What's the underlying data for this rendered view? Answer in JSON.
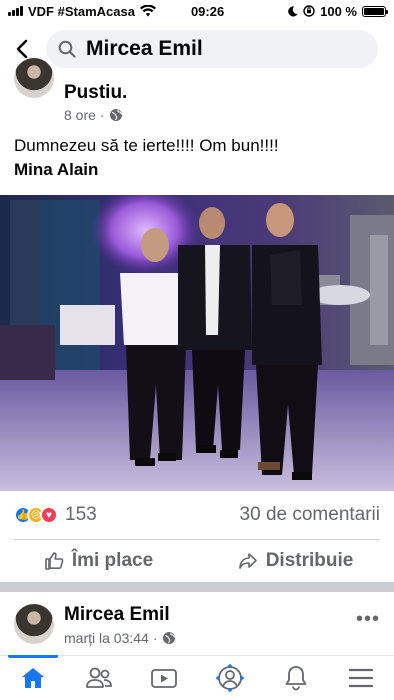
{
  "status_bar": {
    "carrier": "VDF #StamAcasa",
    "time": "09:26",
    "battery": "100 %",
    "battery_level": 1.0
  },
  "search": {
    "query": "Mircea Emil",
    "icon": "search-icon"
  },
  "post1": {
    "author": "Pustiu.",
    "time": "8 ore",
    "text_line1": "Dumnezeu să te ierte!!!! Om bun!!!!",
    "text_line2": "Mina Alain",
    "reaction_count": "153",
    "comments": "30 de comentarii",
    "like_label": "Îmi place",
    "share_label": "Distribuie"
  },
  "post2": {
    "author": "Mircea Emil",
    "time": "marți la 03:44"
  },
  "colors": {
    "accent": "#1877f2",
    "like": "#1877f2",
    "sad": "#f7b125",
    "love": "#f33e58",
    "secondary_text": "#65676b"
  },
  "nav": [
    "home-icon",
    "friends-icon",
    "watch-icon",
    "profile-icon",
    "notifications-icon",
    "menu-icon"
  ]
}
